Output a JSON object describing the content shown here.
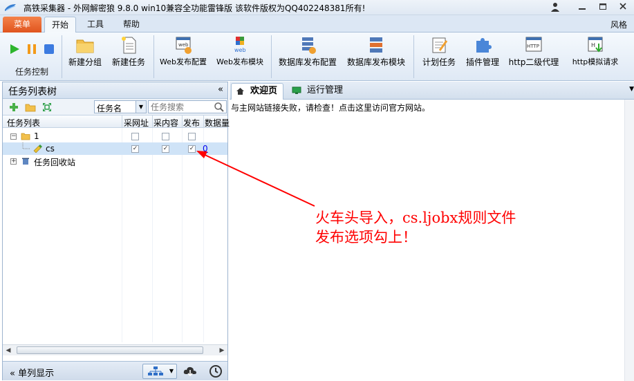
{
  "window": {
    "title": "高铁采集器 - 外网解密狼 9.8.0 win10兼容全功能雷锋版  该软件版权为QQ402248381所有!",
    "controls": [
      "user-icon",
      "minimize-icon",
      "restore-icon",
      "close-icon"
    ]
  },
  "ribbon": {
    "menu_label": "菜单",
    "tabs": [
      {
        "label": "开始",
        "active": true
      },
      {
        "label": "工具",
        "active": false
      },
      {
        "label": "帮助",
        "active": false
      }
    ],
    "style_label": "风格",
    "group_task_control": "任务控制",
    "buttons": {
      "run": "run-icon",
      "pause": "pause-icon",
      "stop": "stop-icon",
      "new_group": "新建分组",
      "new_task": "新建任务",
      "web_publish_config": "Web发布配置",
      "web_publish_module": "Web发布模块",
      "db_publish_config": "数据库发布配置",
      "db_publish_module": "数据库发布模块",
      "schedule_task": "计划任务",
      "plugin_manage": "插件管理",
      "http_proxy": "http二级代理",
      "http_simulate": "http模拟请求"
    }
  },
  "left_panel": {
    "title": "任务列表树",
    "collapse_glyph": "«",
    "search_field": "任务名",
    "search_placeholder": "任务搜索",
    "columns": [
      "任务列表",
      "采网址",
      "采内容",
      "发布",
      "数据量"
    ],
    "rows": [
      {
        "expander": "⊟",
        "label": "1",
        "type": "folder",
        "cols": [
          false,
          false,
          false
        ],
        "count": ""
      },
      {
        "label": "cs",
        "type": "task",
        "cols": [
          true,
          true,
          true
        ],
        "count": "0",
        "selected": true
      },
      {
        "expander": "⊞",
        "label": "任务回收站",
        "type": "recycle"
      }
    ],
    "footer": {
      "single_display": "单列显示",
      "icons": [
        "tree-layout-icon",
        "cloud-download-icon",
        "clock-icon"
      ]
    }
  },
  "right_panel": {
    "tabs": [
      {
        "label": "欢迎页",
        "active": true
      },
      {
        "label": "运行管理",
        "active": false
      }
    ],
    "message": "与主网站链接失败，请检查！点击这里访问官方网站。"
  },
  "annotation": {
    "line1": "火车头导入，cs.ljobx规则文件",
    "line2": "发布选项勾上！",
    "color": "#ff0000"
  }
}
